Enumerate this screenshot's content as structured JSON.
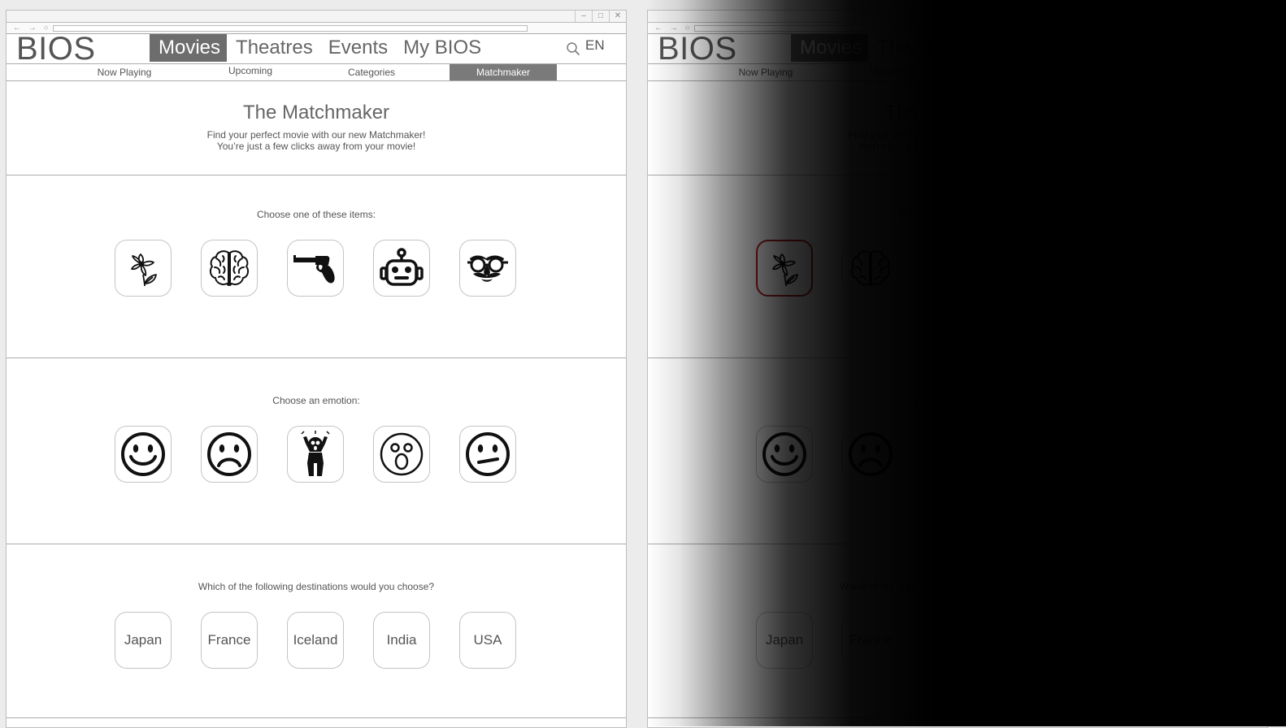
{
  "window": {
    "nav_arrows": "← → ○",
    "controls": [
      "–",
      "□",
      "✕"
    ]
  },
  "header": {
    "logo": "BIOS",
    "nav": [
      "Movies",
      "Theatres",
      "Events",
      "My BIOS"
    ],
    "active_nav": "Movies",
    "lang": "EN"
  },
  "subnav": [
    "Now Playing",
    "Upcoming",
    "Categories",
    "Matchmaker"
  ],
  "hero": {
    "title": "The Matchmaker",
    "line1": "Find your perfect movie with our new Matchmaker!",
    "line2": "You’re just a few clicks away from your movie!"
  },
  "items": {
    "question": "Choose one of these items:",
    "icons": [
      "flower-icon",
      "brain-icon",
      "revolver-icon",
      "robot-icon",
      "disguise-glasses-icon"
    ]
  },
  "emotions": {
    "question": "Choose an emotion:",
    "icons": [
      "happy-face-icon",
      "sad-face-icon",
      "scared-person-icon",
      "surprised-face-icon",
      "confused-face-icon"
    ]
  },
  "destinations": {
    "question": "Which of the following destinations would you choose?",
    "options": [
      "Japan",
      "France",
      "Iceland",
      "India",
      "USA"
    ]
  },
  "selected_item_right_frame": "flower-icon",
  "colors": {
    "active_nav": "#6d6d6d",
    "selected_border": "#b21f24"
  }
}
